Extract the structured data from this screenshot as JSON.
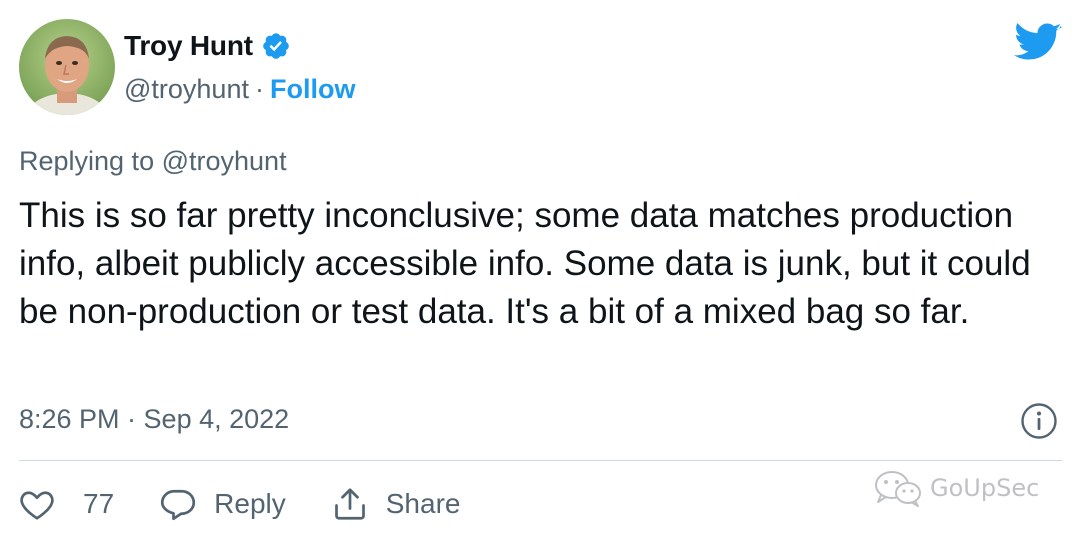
{
  "author": {
    "display_name": "Troy Hunt",
    "handle": "@troyhunt",
    "separator": "·",
    "follow_label": "Follow",
    "verified": true,
    "avatar_icon": "profile-photo"
  },
  "reply_context": {
    "prefix": "Replying to",
    "mention": "@troyhunt"
  },
  "tweet": {
    "text": "This is so far pretty inconclusive; some data matches production info, albeit publicly accessible info. Some data is junk, but it could be non-production or test data. It's a bit of a mixed bag so far.",
    "timestamp": "8:26 PM · Sep 4, 2022"
  },
  "actions": {
    "like_count": "77",
    "reply_label": "Reply",
    "share_label": "Share"
  },
  "watermark": {
    "text": "GoUpSec"
  },
  "colors": {
    "accent": "#1d9bf0",
    "text_primary": "#0f1419",
    "text_secondary": "#536471",
    "divider": "#cfd9de"
  },
  "icons": [
    "twitter-bird-icon",
    "verified-badge-icon",
    "info-icon",
    "heart-icon",
    "reply-icon",
    "share-icon",
    "wechat-icon"
  ]
}
